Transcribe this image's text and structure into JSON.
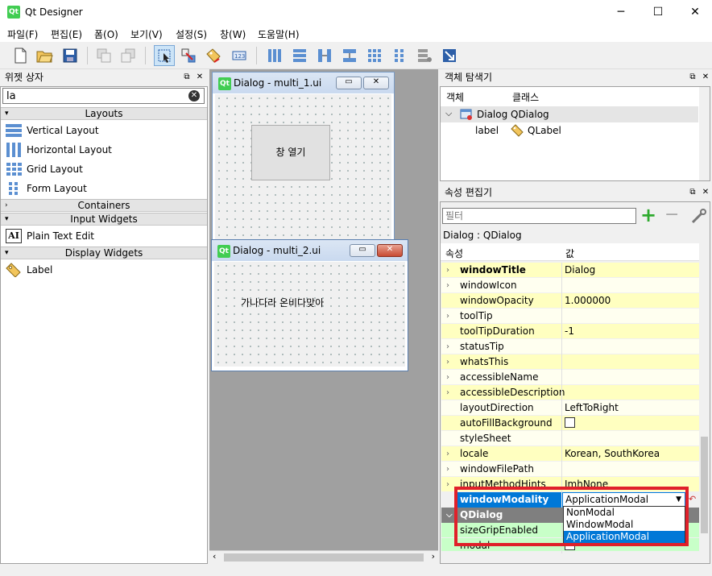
{
  "window": {
    "title": "Qt Designer",
    "icon_text": "Qt",
    "minimize": "─",
    "maximize": "☐",
    "close": "✕"
  },
  "menu": [
    "파일(F)",
    "편집(E)",
    "폼(O)",
    "보기(V)",
    "설정(S)",
    "창(W)",
    "도움말(H)"
  ],
  "widget_box": {
    "title": "위젯 상자",
    "filter_value": "la",
    "categories": {
      "layouts": "Layouts",
      "containers": "Containers",
      "input": "Input Widgets",
      "display": "Display Widgets"
    },
    "layout_items": [
      "Vertical Layout",
      "Horizontal Layout",
      "Grid Layout",
      "Form Layout"
    ],
    "input_items": [
      "Plain Text Edit"
    ],
    "display_items": [
      "Label"
    ]
  },
  "dialog1": {
    "title": "Dialog - multi_1.ui",
    "button_text": "창 열기"
  },
  "dialog2": {
    "title": "Dialog - multi_2.ui",
    "label_text": "가나다라 온비다맞아"
  },
  "object_inspector": {
    "title": "객체 탐색기",
    "col_object": "객체",
    "col_class": "클래스",
    "rows": [
      {
        "object": "Dialog",
        "class": "QDialog"
      },
      {
        "object": "label",
        "class": "QLabel"
      }
    ]
  },
  "property_editor": {
    "title": "속성 편집기",
    "filter_placeholder": "필터",
    "context": "Dialog : QDialog",
    "col_property": "속성",
    "col_value": "값",
    "rows": [
      {
        "name": "windowTitle",
        "value": "Dialog"
      },
      {
        "name": "windowIcon",
        "value": ""
      },
      {
        "name": "windowOpacity",
        "value": "1.000000"
      },
      {
        "name": "toolTip",
        "value": ""
      },
      {
        "name": "toolTipDuration",
        "value": "-1"
      },
      {
        "name": "statusTip",
        "value": ""
      },
      {
        "name": "whatsThis",
        "value": ""
      },
      {
        "name": "accessibleName",
        "value": ""
      },
      {
        "name": "accessibleDescription",
        "value": ""
      },
      {
        "name": "layoutDirection",
        "value": "LeftToRight"
      },
      {
        "name": "autoFillBackground",
        "value": ""
      },
      {
        "name": "styleSheet",
        "value": ""
      },
      {
        "name": "locale",
        "value": "Korean, SouthKorea"
      },
      {
        "name": "windowFilePath",
        "value": ""
      },
      {
        "name": "inputMethodHints",
        "value": "ImhNone"
      }
    ],
    "selected": {
      "name": "windowModality",
      "value": "ApplicationModal"
    },
    "section": "QDialog",
    "after_rows": [
      {
        "name": "sizeGripEnabled",
        "value": ""
      },
      {
        "name": "modal",
        "value": ""
      }
    ],
    "dropdown_options": [
      "NonModal",
      "WindowModal",
      "ApplicationModal"
    ],
    "highlight_color": "#e0202a",
    "accent": "#0078d7"
  }
}
